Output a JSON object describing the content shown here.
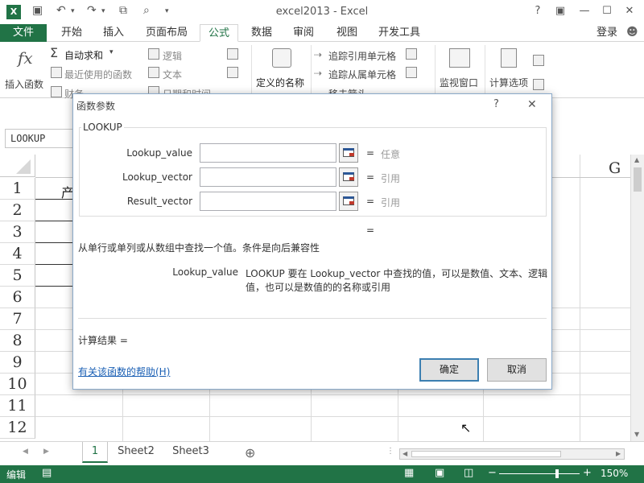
{
  "window": {
    "title": "excel2013 - Excel",
    "help": "?",
    "minimize": "—",
    "maximize": "☐",
    "close": "✕",
    "signin": "登录"
  },
  "tabs": [
    "文件",
    "开始",
    "插入",
    "页面布局",
    "公式",
    "数据",
    "审阅",
    "视图",
    "开发工具"
  ],
  "ribbon": {
    "insert_function": "插入函数",
    "fx": "fx",
    "autosum": "自动求和",
    "recent": "最近使用的函数",
    "financial": "财务",
    "logical": "逻辑",
    "text": "文本",
    "datetime": "日期和时间",
    "define_name": "定义的名称",
    "trace_precedents": "追踪引用单元格",
    "trace_dependents": "追踪从属单元格",
    "remove_arrows": "移去箭头",
    "watch": "监视窗口",
    "calc_options": "计算选项"
  },
  "name_box": "LOOKUP",
  "grid": {
    "rows": [
      "1",
      "2",
      "3",
      "4",
      "5",
      "6",
      "7",
      "8",
      "9",
      "10",
      "11",
      "12"
    ],
    "col_g": "G",
    "cell_a1": "产"
  },
  "sheets": {
    "active": "1",
    "others": [
      "Sheet2",
      "Sheet3"
    ],
    "add": "⊕"
  },
  "status": {
    "mode": "编辑",
    "zoom": "150%"
  },
  "dialog": {
    "title": "函数参数",
    "help": "?",
    "close": "✕",
    "function_name": "LOOKUP",
    "args": [
      {
        "label": "Lookup_value",
        "eq": "=",
        "value": "任意"
      },
      {
        "label": "Lookup_vector",
        "eq": "=",
        "value": "引用"
      },
      {
        "label": "Result_vector",
        "eq": "=",
        "value": "引用"
      }
    ],
    "result_eq": "=",
    "description": "从单行或单列或从数组中查找一个值。条件是向后兼容性",
    "arg_name": "Lookup_value",
    "arg_desc_line1": "LOOKUP 要在 Lookup_vector 中查找的值，可以是数值、文本、逻辑",
    "arg_desc_line2": "值，也可以是数值的的名称或引用",
    "calc_result": "计算结果 =",
    "help_link": "有关该函数的帮助(H)",
    "ok": "确定",
    "cancel": "取消"
  }
}
